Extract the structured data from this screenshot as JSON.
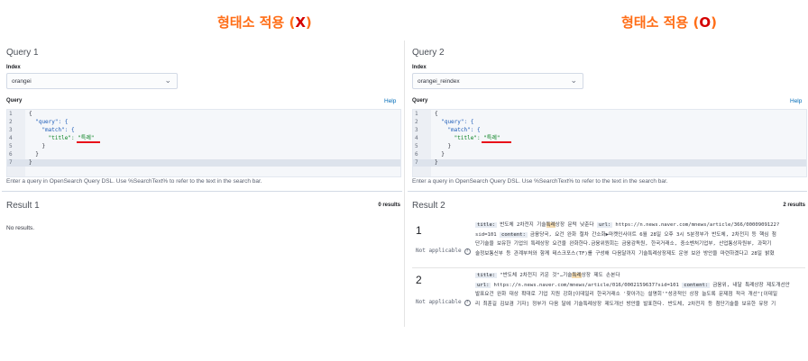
{
  "headings": {
    "left": {
      "text": "형태소 적용 (",
      "mark": "X",
      "close": ")"
    },
    "right": {
      "text": "형태소 적용 (",
      "mark": "O",
      "close": ")"
    }
  },
  "colors": {
    "heading": "#ff6d16",
    "mark": "#d40000",
    "link": "#006bb8",
    "underline": "#e8111a"
  },
  "panels": [
    {
      "query_title": "Query 1",
      "index_label": "Index",
      "index_value": "orangei",
      "query_label": "Query",
      "help": "Help",
      "code": [
        "{",
        "  \"query\": {",
        "    \"match\": {",
        "      \"title\": \"특례\"",
        "    }",
        "  }",
        "}"
      ],
      "line_numbers": [
        "1",
        "2",
        "3",
        "4",
        "5",
        "6",
        "7"
      ],
      "hint": "Enter a query in OpenSearch Query DSL. Use %SearchText% to refer to the text in the search bar.",
      "result_title": "Result 1",
      "result_count": "0 results",
      "no_results": "No results."
    },
    {
      "query_title": "Query 2",
      "index_label": "Index",
      "index_value": "orangei_reindex",
      "query_label": "Query",
      "help": "Help",
      "code": [
        "{",
        "  \"query\": {",
        "    \"match\": {",
        "      \"title\": \"특례\"",
        "    }",
        "  }",
        "}"
      ],
      "line_numbers": [
        "1",
        "2",
        "3",
        "4",
        "5",
        "6",
        "7"
      ],
      "hint": "Enter a query in OpenSearch Query DSL. Use %SearchText% to refer to the text in the search bar.",
      "result_title": "Result 2",
      "result_count": "2 results",
      "results": [
        {
          "rank": "1",
          "score": "Not applicable",
          "l1_title_label": "title:",
          "l1_title_pre": "반도체 2차전지 기술",
          "l1_title_hl": "특례",
          "l1_title_post": "상장 문턱 낮춘다",
          "l1_url_label": "url:",
          "l1_url": "https://n.news.naver.com/mnews/article/366/0000909122?",
          "l2_pre": "sid=101",
          "l2_content_label": "content:",
          "l2_text": "금융당국, 요건 완화 절차 간소화▶마켓인사이트 6월 28일 오후 3시 5분정부가 반도체, 2차전지 등 핵심 첨",
          "l3": "단기술을 보유한 기업의 특례상장 요건을 완화한다.금융위원회는 금융감독원, 한국거래소, 중소벤처기업부, 산업통상자원부, 과학기",
          "l4": "술정보통신부 등 관계부처와 함께 테스크포스(TF)를 구성해 다음달까지 기술특례상장제도 운영 보완 방안을 마련하겠다고 28일 밝혔"
        },
        {
          "rank": "2",
          "score": "Not applicable",
          "l1_title_label": "title:",
          "l1_title_pre": "\"반도체 2차전지 키운 것\"…기술",
          "l1_title_hl": "특례",
          "l1_title_post": "상장 제도 손본다",
          "l2_url_label": "url:",
          "l2_url": "https://n.news.naver.com/mnews/article/016/0002159637?sid=101",
          "l2_content_label": "content:",
          "l2_text": "금융위, 내달 특례상장 제도개선안",
          "l3": "발표요건 완화 대상 확대로 기업 지원 강화[이데일리 한국거래소 '찾아가는 설명회'\"성공적인 상장 늘도록 문제점 적극 개선\"[이데일",
          "l4": "리 최훈길 김보겸 기자] 정부가 다음 달에 기술특례상장 제도개선 방안을 발표한다. 반도체, 2차전지 등 첨단기술을 보유한 유망 기"
        }
      ]
    }
  ]
}
